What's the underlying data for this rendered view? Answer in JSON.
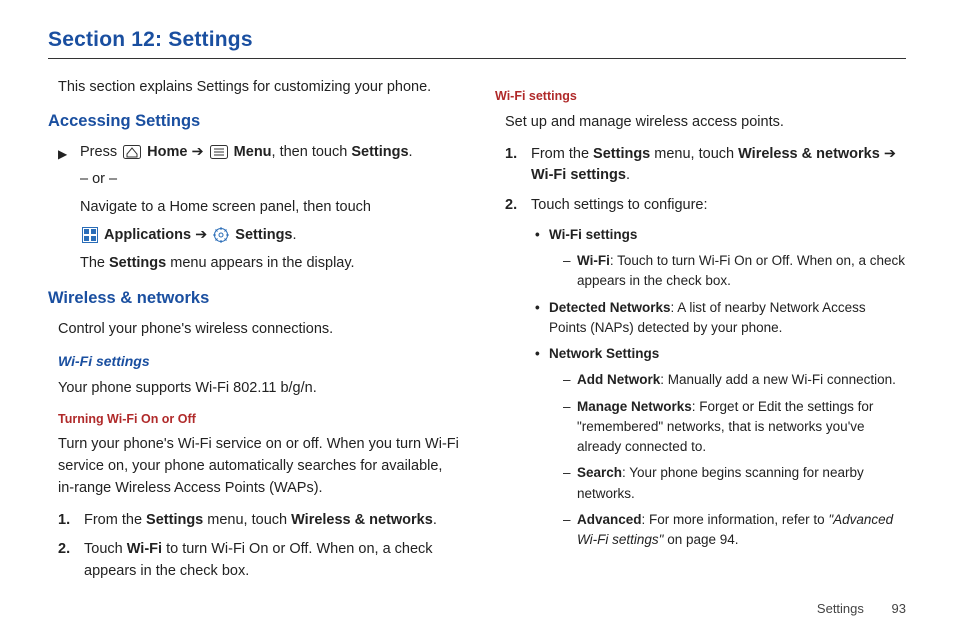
{
  "title": "Section 12: Settings",
  "col1": {
    "intro": "This section explains Settings for customizing your phone.",
    "h_accessing": "Accessing Settings",
    "press": "Press ",
    "home": " Home",
    "menu": " Menu",
    "then_touch": ", then touch ",
    "settings_word": "Settings",
    "period": ".",
    "or": "– or –",
    "nav_line": "Navigate to a Home screen panel, then touch",
    "applications": " Applications",
    "settings2": " Settings",
    "appears": "The ",
    "appears2": " menu appears in the display.",
    "h_wireless": "Wireless & networks",
    "control": "Control your phone's wireless connections.",
    "h_wifi_settings": "Wi-Fi settings",
    "supports": "Your phone supports Wi-Fi 802.11 b/g/n.",
    "h_turning": "Turning Wi-Fi On or Off",
    "turn_para": "Turn your phone's Wi-Fi service on or off. When you turn Wi-Fi service on, your phone automatically searches for available, in-range Wireless Access Points (WAPs).",
    "step1_a": "From the ",
    "step1_b": " menu, touch ",
    "step1_c": "Wireless & networks",
    "step2_a": "Touch ",
    "step2_b": "Wi-Fi",
    "step2_c": " to turn Wi-Fi On or Off. When on, a check appears in the check box."
  },
  "col2": {
    "h_wifi_settings": "Wi-Fi settings",
    "setup": "Set up and manage wireless access points.",
    "step1_a": "From the ",
    "step1_b": "Settings",
    "step1_c": " menu, touch ",
    "step1_d": "Wireless & networks",
    "step1_e": "Wi-Fi settings",
    "step2": "Touch settings to configure:",
    "bul1_label": "Wi-Fi settings",
    "bul1_sub_label": "Wi-Fi",
    "bul1_sub_text": ": Touch to turn Wi-Fi On or Off. When on, a check appears in the check box.",
    "bul2_label": "Detected Networks",
    "bul2_text": ": A list of nearby Network Access Points (NAPs) detected by your phone.",
    "bul3_label": "Network Settings",
    "d1_label": "Add Network",
    "d1_text": ": Manually add a new Wi-Fi connection.",
    "d2_label": "Manage Networks",
    "d2_text": ": Forget or Edit the settings for \"remembered\" networks, that is networks you've already connected to.",
    "d3_label": "Search",
    "d3_text": ": Your phone begins scanning for nearby networks.",
    "d4_label": "Advanced",
    "d4_text_a": ": For more information, refer to ",
    "d4_ref": "\"Advanced Wi-Fi settings\"",
    "d4_text_b": " on page 94."
  },
  "arrow": " ➔ ",
  "footer": {
    "label": "Settings",
    "page": "93"
  }
}
